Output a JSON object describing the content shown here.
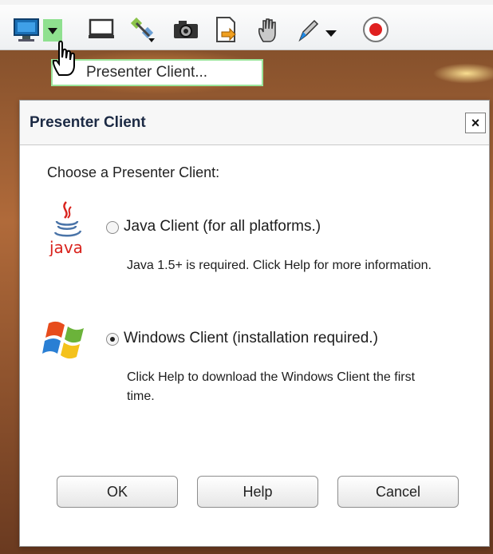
{
  "toolbar": {
    "icons": [
      "monitor-icon",
      "dropdown-arrow-icon",
      "whiteboard-icon",
      "satellite-icon",
      "camera-icon",
      "share-document-icon",
      "hand-icon",
      "pen-icon",
      "pen-dropdown-arrow-icon",
      "record-icon"
    ]
  },
  "tooltip": {
    "label": "Presenter Client..."
  },
  "dialog": {
    "title": "Presenter Client",
    "close_label": "×",
    "prompt": "Choose a Presenter Client:",
    "options": [
      {
        "icon_text": "java",
        "label": "Java Client (for all platforms.)",
        "description": "Java 1.5+ is required. Click Help for more information.",
        "selected": false
      },
      {
        "label": "Windows Client (installation required.)",
        "description": "Click Help to download the Windows Client the first time.",
        "selected": true
      }
    ],
    "buttons": {
      "ok": "OK",
      "help": "Help",
      "cancel": "Cancel"
    }
  },
  "colors": {
    "tooltip_border": "#9be59b",
    "title_text": "#1c2a44",
    "java_red": "#d9231d",
    "java_blue": "#4a74a8"
  }
}
